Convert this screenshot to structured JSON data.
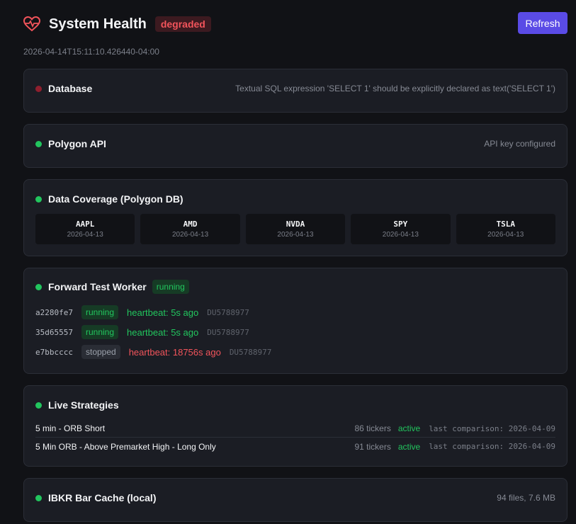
{
  "header": {
    "title": "System Health",
    "status_badge": "degraded",
    "refresh_label": "Refresh",
    "timestamp": "2026-04-14T15:11:10.426440-04:00"
  },
  "colors": {
    "accent": "#5a4be6",
    "ok": "#22c55e",
    "error": "#f2545b",
    "error_dot": "#8f1f2e"
  },
  "database": {
    "title": "Database",
    "status": "error",
    "note": "Textual SQL expression 'SELECT 1' should be explicitly declared as text('SELECT 1')"
  },
  "polygon_api": {
    "title": "Polygon API",
    "status": "ok",
    "note": "API key configured"
  },
  "coverage": {
    "title": "Data Coverage (Polygon DB)",
    "status": "ok",
    "tickers": [
      {
        "symbol": "AAPL",
        "date": "2026-04-13"
      },
      {
        "symbol": "AMD",
        "date": "2026-04-13"
      },
      {
        "symbol": "NVDA",
        "date": "2026-04-13"
      },
      {
        "symbol": "SPY",
        "date": "2026-04-13"
      },
      {
        "symbol": "TSLA",
        "date": "2026-04-13"
      }
    ]
  },
  "worker": {
    "title": "Forward Test Worker",
    "status": "running",
    "rows": [
      {
        "id": "a2280fe7",
        "state": "running",
        "heartbeat": "heartbeat: 5s ago",
        "account": "DU5788977"
      },
      {
        "id": "35d65557",
        "state": "running",
        "heartbeat": "heartbeat: 5s ago",
        "account": "DU5788977"
      },
      {
        "id": "e7bbcccc",
        "state": "stopped",
        "heartbeat": "heartbeat: 18756s ago",
        "account": "DU5788977"
      }
    ]
  },
  "strategies": {
    "title": "Live Strategies",
    "rows": [
      {
        "name": "5 min - ORB Short",
        "count": "86 tickers",
        "status": "active",
        "comparison": "last comparison: 2026-04-09"
      },
      {
        "name": "5 Min ORB - Above Premarket High - Long Only",
        "count": "91 tickers",
        "status": "active",
        "comparison": "last comparison: 2026-04-09"
      }
    ]
  },
  "ibkr_cache": {
    "title": "IBKR Bar Cache (local)",
    "status": "ok",
    "note": "94 files, 7.6 MB"
  }
}
